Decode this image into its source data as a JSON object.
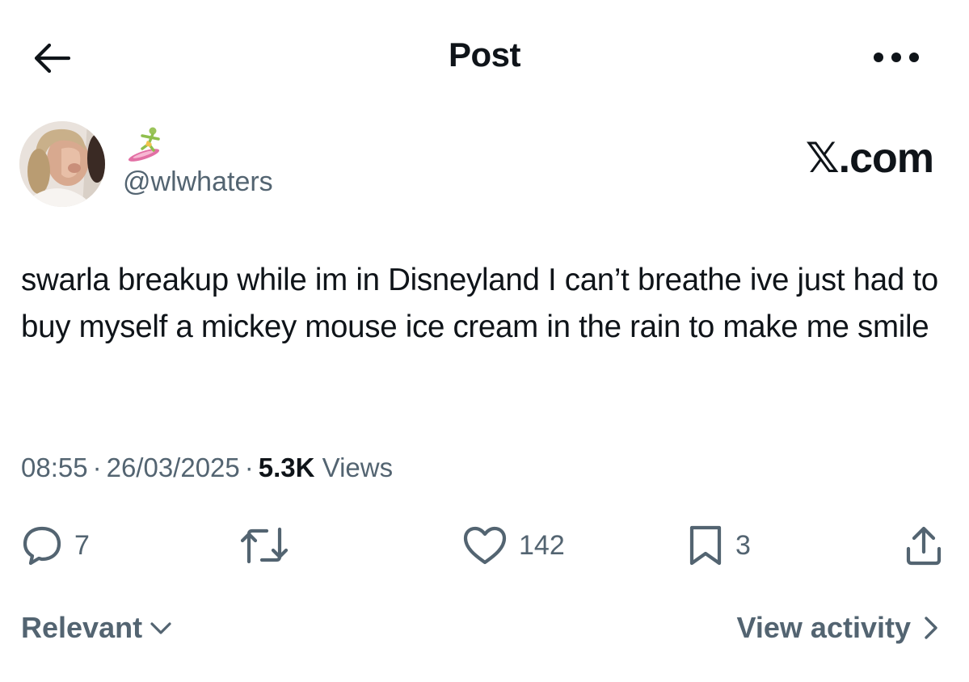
{
  "header": {
    "title": "Post",
    "back_icon": "arrow-left-icon",
    "more_icon": "more-horizontal-icon"
  },
  "author": {
    "emoji": "🏄",
    "handle": "@wlwhaters"
  },
  "source": {
    "logo_text": "𝕏.com"
  },
  "tweet": {
    "text": "swarla breakup while im in Disneyland I can’t breathe ive just had to buy myself a mickey mouse ice cream in the rain to make me smile"
  },
  "meta": {
    "time": "08:55",
    "separator": "·",
    "date": "26/03/2025",
    "views_count": "5.3K",
    "views_label": "Views"
  },
  "actions": {
    "replies": "7",
    "reposts": "",
    "likes": "142",
    "bookmarks": "3"
  },
  "footer": {
    "sort_label": "Relevant",
    "activity_label": "View activity"
  },
  "colors": {
    "text_primary": "#0f1419",
    "text_secondary": "#536471",
    "background": "#ffffff"
  }
}
